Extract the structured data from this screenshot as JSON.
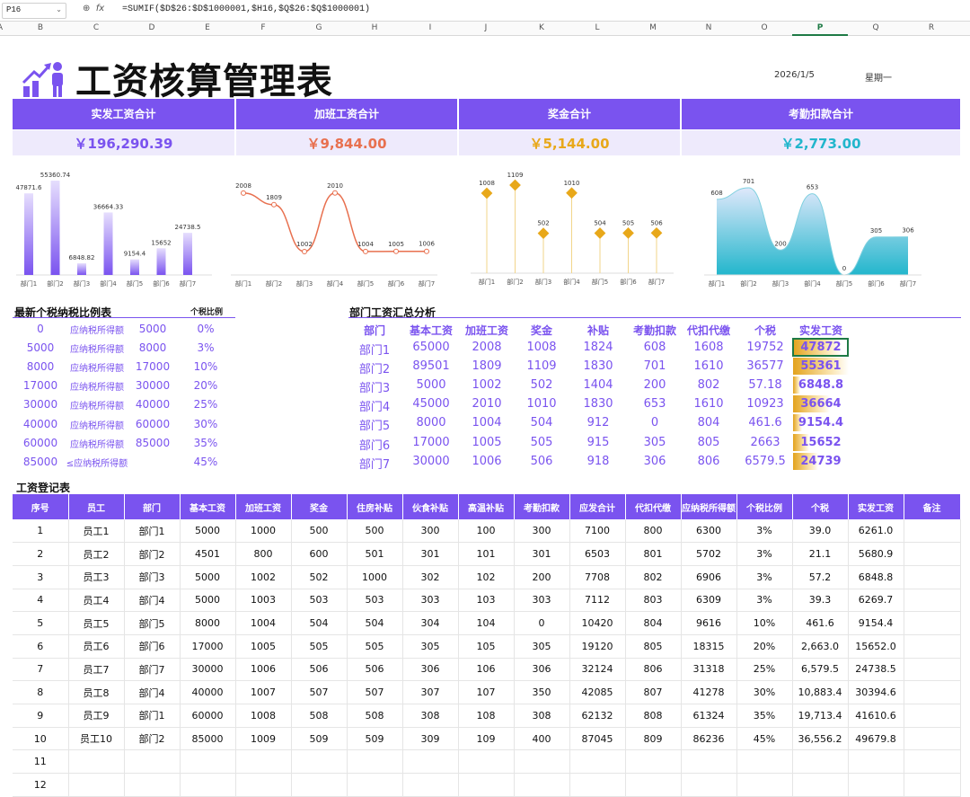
{
  "formula_bar": {
    "cell_ref": "P16",
    "formula": "=SUMIF($D$26:$D$1000001,$H16,$Q$26:$Q$1000001)"
  },
  "columns": [
    "A",
    "B",
    "C",
    "D",
    "E",
    "F",
    "G",
    "H",
    "I",
    "J",
    "K",
    "L",
    "M",
    "N",
    "O",
    "P",
    "Q",
    "R"
  ],
  "selected_column": "P",
  "header": {
    "title": "工资核算管理表",
    "date": "2026/1/5",
    "weekday": "星期一"
  },
  "kpis": [
    {
      "label": "实发工资合计",
      "value": "￥196,290.39",
      "color": "#7a53ef"
    },
    {
      "label": "加班工资合计",
      "value": "￥9,844.00",
      "color": "#e8704f"
    },
    {
      "label": "奖金合计",
      "value": "￥5,144.00",
      "color": "#e8a81a"
    },
    {
      "label": "考勤扣款合计",
      "value": "￥2,773.00",
      "color": "#22b6cc"
    }
  ],
  "chart_data": [
    {
      "type": "bar",
      "categories": [
        "部门1",
        "部门2",
        "部门3",
        "部门4",
        "部门5",
        "部门6",
        "部门7"
      ],
      "values": [
        47871.6,
        55360.74,
        6848.82,
        36664.33,
        9154.4,
        15652,
        24738.5
      ],
      "labels": [
        "47871.6",
        "55360.74",
        "6848.82",
        "36664.33",
        "9154.4",
        "15652",
        "24738.5"
      ],
      "ylim": [
        0,
        58000
      ],
      "color": "#7a53ef"
    },
    {
      "type": "line",
      "categories": [
        "部门1",
        "部门2",
        "部门3",
        "部门4",
        "部门5",
        "部门6",
        "部门7"
      ],
      "values": [
        2008,
        1809,
        1002,
        2010,
        1004,
        1005,
        1006
      ],
      "ylim": [
        600,
        2300
      ],
      "color": "#e8704f"
    },
    {
      "type": "lollipop",
      "categories": [
        "部门1",
        "部门2",
        "部门3",
        "部门4",
        "部门5",
        "部门6",
        "部门7"
      ],
      "values": [
        1008,
        1109,
        502,
        1010,
        504,
        505,
        506
      ],
      "ylim": [
        0,
        1200
      ],
      "color": "#e8a81a"
    },
    {
      "type": "area",
      "categories": [
        "部门1",
        "部门2",
        "部门3",
        "部门4",
        "部门5",
        "部门6",
        "部门7"
      ],
      "values": [
        608,
        701,
        200,
        653,
        0,
        305,
        306
      ],
      "ylim": [
        0,
        780
      ],
      "color": "#22b6cc"
    }
  ],
  "tax_table": {
    "title": "最新个税纳税比例表",
    "rate_header": "个税比例",
    "rows": [
      {
        "low": "0",
        "label": "应纳税所得额",
        "high": "5000",
        "rate": "0%"
      },
      {
        "low": "5000",
        "label": "应纳税所得额",
        "high": "8000",
        "rate": "3%"
      },
      {
        "low": "8000",
        "label": "应纳税所得额",
        "high": "17000",
        "rate": "10%"
      },
      {
        "low": "17000",
        "label": "应纳税所得额",
        "high": "30000",
        "rate": "20%"
      },
      {
        "low": "30000",
        "label": "应纳税所得额",
        "high": "40000",
        "rate": "25%"
      },
      {
        "low": "40000",
        "label": "应纳税所得额",
        "high": "60000",
        "rate": "30%"
      },
      {
        "low": "60000",
        "label": "应纳税所得额",
        "high": "85000",
        "rate": "35%"
      },
      {
        "low": "85000",
        "label": "≤应纳税所得额",
        "high": "",
        "rate": "45%"
      }
    ]
  },
  "dept_summary": {
    "title": "部门工资汇总分析",
    "headers": [
      "部门",
      "基本工资",
      "加班工资",
      "奖金",
      "补贴",
      "考勤扣款",
      "代扣代缴",
      "个税",
      "实发工资"
    ],
    "rows": [
      [
        "部门1",
        "65000",
        "2008",
        "1008",
        "1824",
        "608",
        "1608",
        "19752",
        "47872"
      ],
      [
        "部门2",
        "89501",
        "1809",
        "1109",
        "1830",
        "701",
        "1610",
        "36577",
        "55361"
      ],
      [
        "部门3",
        "5000",
        "1002",
        "502",
        "1404",
        "200",
        "802",
        "57.18",
        "6848.8"
      ],
      [
        "部门4",
        "45000",
        "2010",
        "1010",
        "1830",
        "653",
        "1610",
        "10923",
        "36664"
      ],
      [
        "部门5",
        "8000",
        "1004",
        "504",
        "912",
        "0",
        "804",
        "461.6",
        "9154.4"
      ],
      [
        "部门6",
        "17000",
        "1005",
        "505",
        "915",
        "305",
        "805",
        "2663",
        "15652"
      ],
      [
        "部门7",
        "30000",
        "1006",
        "506",
        "918",
        "306",
        "806",
        "6579.5",
        "24739"
      ]
    ],
    "net_values": [
      47872,
      55361,
      6848.8,
      36664,
      9154.4,
      15652,
      24739
    ]
  },
  "register": {
    "title": "工资登记表",
    "headers": [
      "序号",
      "员工",
      "部门",
      "基本工资",
      "加班工资",
      "奖金",
      "住房补贴",
      "伙食补贴",
      "高温补贴",
      "考勤扣款",
      "应发合计",
      "代扣代缴",
      "应纳税所得额",
      "个税比例",
      "个税",
      "实发工资",
      "备注"
    ],
    "rows": [
      [
        "1",
        "员工1",
        "部门1",
        "5000",
        "1000",
        "500",
        "500",
        "300",
        "100",
        "300",
        "7100",
        "800",
        "6300",
        "3%",
        "39.0",
        "6261.0",
        ""
      ],
      [
        "2",
        "员工2",
        "部门2",
        "4501",
        "800",
        "600",
        "501",
        "301",
        "101",
        "301",
        "6503",
        "801",
        "5702",
        "3%",
        "21.1",
        "5680.9",
        ""
      ],
      [
        "3",
        "员工3",
        "部门3",
        "5000",
        "1002",
        "502",
        "1000",
        "302",
        "102",
        "200",
        "7708",
        "802",
        "6906",
        "3%",
        "57.2",
        "6848.8",
        ""
      ],
      [
        "4",
        "员工4",
        "部门4",
        "5000",
        "1003",
        "503",
        "503",
        "303",
        "103",
        "303",
        "7112",
        "803",
        "6309",
        "3%",
        "39.3",
        "6269.7",
        ""
      ],
      [
        "5",
        "员工5",
        "部门5",
        "8000",
        "1004",
        "504",
        "504",
        "304",
        "104",
        "0",
        "10420",
        "804",
        "9616",
        "10%",
        "461.6",
        "9154.4",
        ""
      ],
      [
        "6",
        "员工6",
        "部门6",
        "17000",
        "1005",
        "505",
        "505",
        "305",
        "105",
        "305",
        "19120",
        "805",
        "18315",
        "20%",
        "2,663.0",
        "15652.0",
        ""
      ],
      [
        "7",
        "员工7",
        "部门7",
        "30000",
        "1006",
        "506",
        "506",
        "306",
        "106",
        "306",
        "32124",
        "806",
        "31318",
        "25%",
        "6,579.5",
        "24738.5",
        ""
      ],
      [
        "8",
        "员工8",
        "部门4",
        "40000",
        "1007",
        "507",
        "507",
        "307",
        "107",
        "350",
        "42085",
        "807",
        "41278",
        "30%",
        "10,883.4",
        "30394.6",
        ""
      ],
      [
        "9",
        "员工9",
        "部门1",
        "60000",
        "1008",
        "508",
        "508",
        "308",
        "108",
        "308",
        "62132",
        "808",
        "61324",
        "35%",
        "19,713.4",
        "41610.6",
        ""
      ],
      [
        "10",
        "员工10",
        "部门2",
        "85000",
        "1009",
        "509",
        "509",
        "309",
        "109",
        "400",
        "87045",
        "809",
        "86236",
        "45%",
        "36,556.2",
        "49679.8",
        ""
      ],
      [
        "11",
        "",
        "",
        "",
        "",
        "",
        "",
        "",
        "",
        "",
        "",
        "",
        "",
        "",
        "",
        "",
        ""
      ],
      [
        "12",
        "",
        "",
        "",
        "",
        "",
        "",
        "",
        "",
        "",
        "",
        "",
        "",
        "",
        "",
        "",
        ""
      ]
    ]
  }
}
